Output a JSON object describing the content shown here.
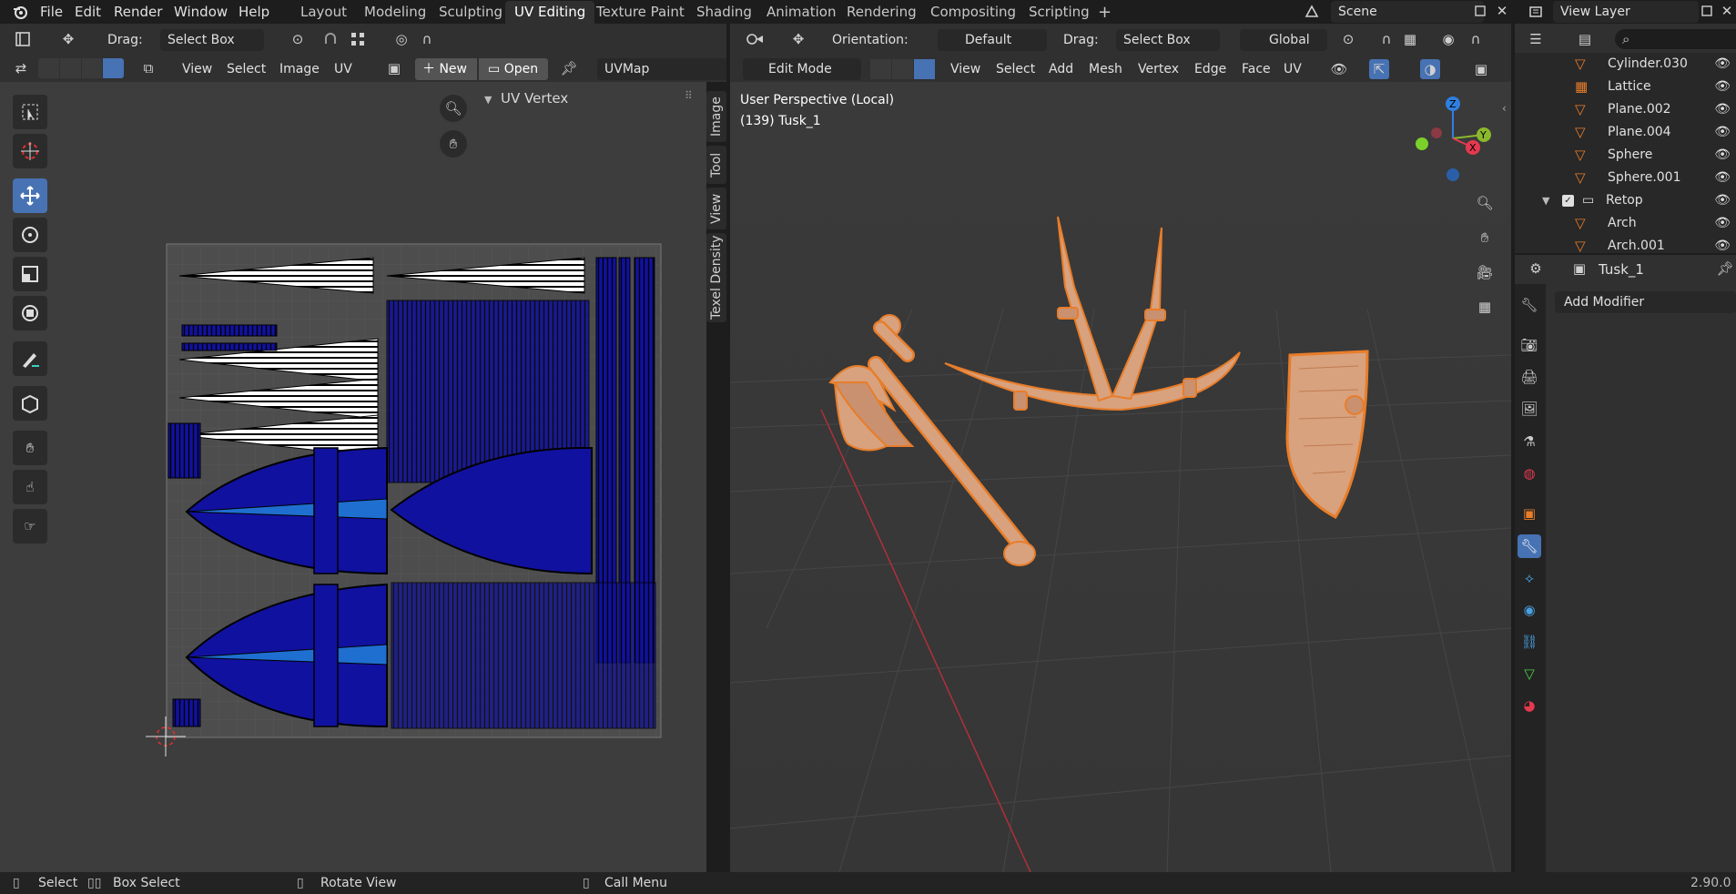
{
  "topbar": {
    "menus": [
      "File",
      "Edit",
      "Render",
      "Window",
      "Help"
    ],
    "workspaces": [
      "Layout",
      "Modeling",
      "Sculpting",
      "UV Editing",
      "Texture Paint",
      "Shading",
      "Animation",
      "Rendering",
      "Compositing",
      "Scripting"
    ],
    "active_workspace": "UV Editing",
    "add_tab": "+",
    "scene": "Scene",
    "view_layer": "View Layer"
  },
  "uv_editor": {
    "drag_label": "Drag:",
    "drag_value": "Select Box",
    "menus": [
      "View",
      "Select",
      "Image",
      "UV"
    ],
    "new_label": "New",
    "open_label": "Open",
    "uvmap": "UVMap",
    "sidebar_panel": "UV Vertex",
    "side_tabs": [
      "Image",
      "Tool",
      "View",
      "Texel Density"
    ]
  },
  "viewport": {
    "orientation_label": "Orientation:",
    "orientation_value": "Default",
    "drag_label": "Drag:",
    "drag_value": "Select Box",
    "transform_space": "Global",
    "mode": "Edit Mode",
    "menus": [
      "View",
      "Select",
      "Add",
      "Mesh",
      "Vertex",
      "Edge",
      "Face",
      "UV"
    ],
    "overlay_title": "User Perspective (Local)",
    "overlay_object": "(139) Tusk_1",
    "gizmo": {
      "z": "Z",
      "y": "Y",
      "x": "X"
    }
  },
  "outliner": {
    "rows": [
      {
        "name": "Cylinder.030"
      },
      {
        "name": "Lattice"
      },
      {
        "name": "Plane.002"
      },
      {
        "name": "Plane.004"
      },
      {
        "name": "Sphere"
      },
      {
        "name": "Sphere.001"
      },
      {
        "name": "Retop"
      },
      {
        "name": "Arch"
      },
      {
        "name": "Arch.001"
      }
    ]
  },
  "properties": {
    "object_name": "Tusk_1",
    "add_modifier": "Add Modifier"
  },
  "statusbar": {
    "items": [
      "Select",
      "Box Select",
      "Rotate View",
      "Call Menu"
    ],
    "version": "2.90.0"
  },
  "colors": {
    "accent": "#4772b3",
    "selection_orange": "#e87d2a",
    "mesh_fill": "#d8a27e",
    "uv_face": "#1111a0",
    "x_axis": "#e5394f",
    "y_axis": "#8bb82c",
    "z_axis": "#2f7fe0"
  }
}
